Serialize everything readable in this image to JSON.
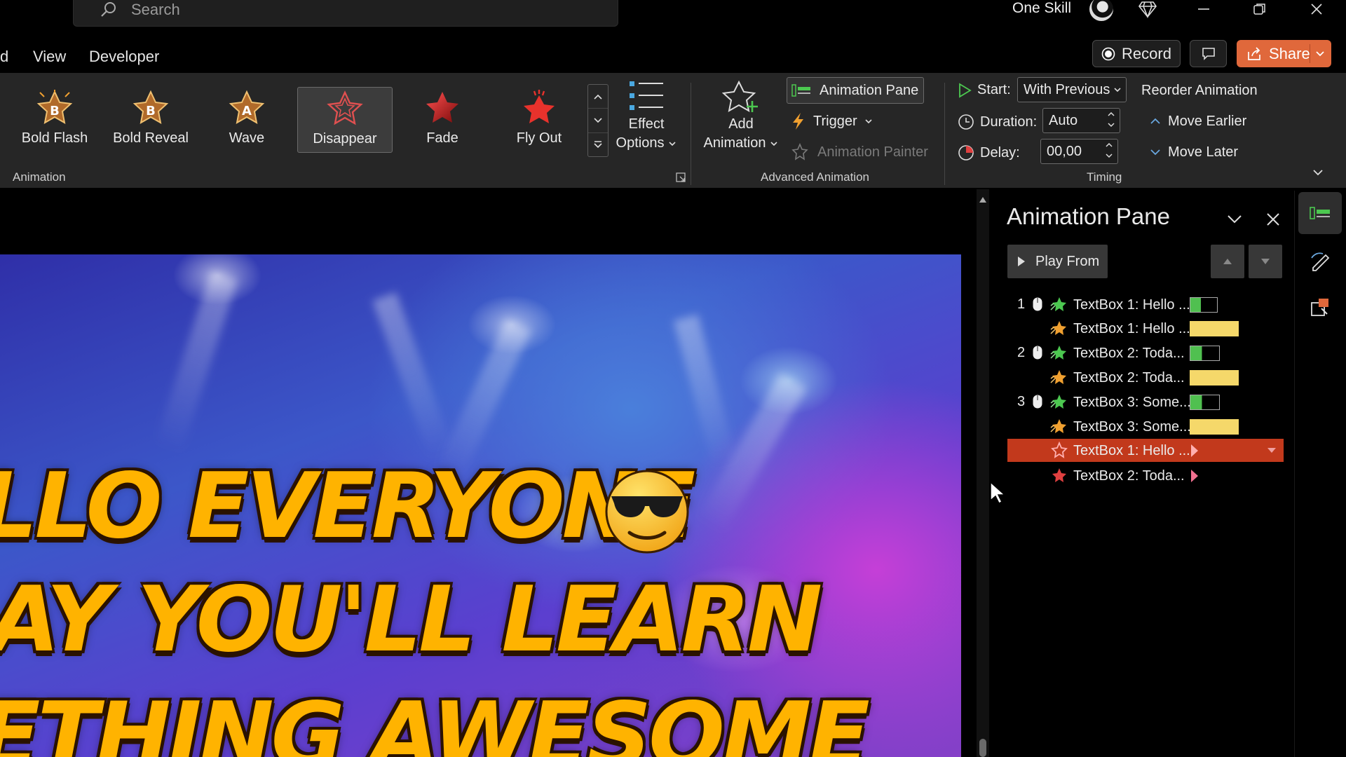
{
  "titlebar": {
    "search_placeholder": "Search",
    "account_name": "One Skill"
  },
  "menu": {
    "partial_tab": "d",
    "tabs": [
      "View",
      "Developer"
    ]
  },
  "actions": {
    "record_label": "Record",
    "share_label": "Share"
  },
  "colors": {
    "accent": "#e0683b",
    "selected_row": "#c2391c",
    "green_bar": "#50c050",
    "yellow_bar": "#f5d86a",
    "emphasis_star": "#f0a030",
    "exit_star": "#e04040"
  },
  "ribbon": {
    "animation_group": {
      "label": "Animation",
      "gallery": [
        {
          "label": "Bold Flash",
          "icon": "bold-flash-star-icon"
        },
        {
          "label": "Bold Reveal",
          "icon": "bold-reveal-star-icon"
        },
        {
          "label": "Wave",
          "icon": "wave-star-icon"
        },
        {
          "label": "Disappear",
          "icon": "disappear-star-icon",
          "selected": true
        },
        {
          "label": "Fade",
          "icon": "fade-star-icon"
        },
        {
          "label": "Fly Out",
          "icon": "fly-out-star-icon"
        }
      ],
      "effect_options": [
        "Effect",
        "Options"
      ]
    },
    "advanced_group": {
      "label": "Advanced Animation",
      "add_animation": [
        "Add",
        "Animation"
      ],
      "animation_pane": "Animation Pane",
      "trigger": "Trigger",
      "animation_painter": "Animation Painter"
    },
    "timing_group": {
      "label": "Timing",
      "start_label": "Start:",
      "start_value": "With Previous",
      "duration_label": "Duration:",
      "duration_value": "Auto",
      "delay_label": "Delay:",
      "delay_value": "00,00",
      "reorder_title": "Reorder Animation",
      "move_earlier": "Move Earlier",
      "move_later": "Move Later"
    }
  },
  "slide": {
    "lines": [
      "LLO EVERYONE",
      "AY YOU'LL LEARN",
      "ETHING AWESOME"
    ]
  },
  "animation_pane": {
    "title": "Animation Pane",
    "play_from": "Play From",
    "items": [
      {
        "number": "1",
        "trigger": "on-click",
        "effect": "entrance",
        "label": "TextBox 1: Hello ..."
      },
      {
        "number": "",
        "trigger": "with-previous",
        "effect": "emphasis",
        "label": "TextBox 1: Hello ..."
      },
      {
        "number": "2",
        "trigger": "on-click",
        "effect": "entrance",
        "label": "TextBox 2: Toda..."
      },
      {
        "number": "",
        "trigger": "with-previous",
        "effect": "emphasis",
        "label": "TextBox 2: Toda..."
      },
      {
        "number": "3",
        "trigger": "on-click",
        "effect": "entrance",
        "label": "TextBox 3: Some..."
      },
      {
        "number": "",
        "trigger": "with-previous",
        "effect": "emphasis",
        "label": "TextBox 3: Some..."
      },
      {
        "number": "",
        "trigger": "with-previous",
        "effect": "exit",
        "label": "TextBox 1: Hello ...",
        "selected": true
      },
      {
        "number": "",
        "trigger": "with-previous",
        "effect": "exit",
        "label": "TextBox 2: Toda..."
      }
    ]
  }
}
